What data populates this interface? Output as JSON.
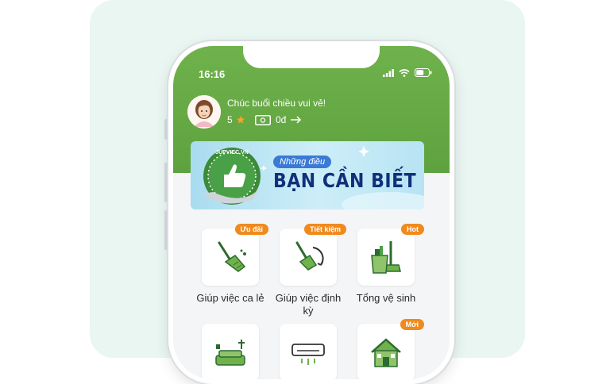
{
  "status_bar": {
    "time": "16:16"
  },
  "user": {
    "greeting": "Chúc buổi chiều vui vẻ!",
    "rating": "5",
    "balance": "0đ"
  },
  "banner": {
    "brand": "JUPVIEC.VN",
    "subtitle": "Những điều",
    "title": "BẠN CẦN BIẾT"
  },
  "services": [
    {
      "label": "Giúp việc ca lẻ",
      "badge": "Ưu đãi",
      "icon": "broom-icon"
    },
    {
      "label": "Giúp việc định kỳ",
      "badge": "Tiết kiệm",
      "icon": "broom-cycle-icon"
    },
    {
      "label": "Tổng vệ sinh",
      "badge": "Hot",
      "icon": "cleaning-bucket-icon"
    },
    {
      "label": "",
      "badge": "",
      "icon": "sofa-icon"
    },
    {
      "label": "",
      "badge": "",
      "icon": "air-conditioner-icon"
    },
    {
      "label": "",
      "badge": "Mới",
      "icon": "house-icon"
    }
  ],
  "colors": {
    "header_green": "#6fb24c",
    "badge_orange": "#f08a1e",
    "banner_title": "#10307a"
  }
}
